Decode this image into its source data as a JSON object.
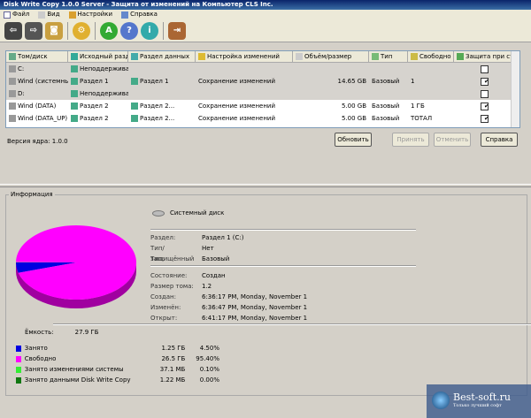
{
  "window": {
    "title": "Disk Write Copy 1.0.0 Server - Защита от изменений на Компьютер CLS Inc."
  },
  "menu": [
    "Файл",
    "Вид",
    "Настройки",
    "Справка"
  ],
  "toolbar": [
    "back",
    "forward",
    "disk",
    "settings",
    "apply",
    "help",
    "info",
    "exit"
  ],
  "columns": [
    "Том/диск",
    "Исходный раздел",
    "Раздел данных",
    "Настройка изменений",
    "Объём/размер",
    "Тип",
    "Свободно",
    "Защита при старте"
  ],
  "rows": [
    {
      "c": [
        "C:",
        "Неподдерживаемый",
        "",
        "",
        "",
        "",
        "",
        ""
      ],
      "checked": false,
      "gray": true
    },
    {
      "c": [
        "Wind (системный)",
        "Раздел 1",
        "Раздел 1",
        "Сохранение изменений",
        "14.65 GB",
        "Базовый",
        "1",
        ""
      ],
      "checked": true,
      "gray": true
    },
    {
      "c": [
        "D:",
        "Неподдерживаемый",
        "",
        "",
        "",
        "",
        "",
        ""
      ],
      "checked": false,
      "gray": true
    },
    {
      "c": [
        "Wind (DATA)",
        "Раздел 2",
        "Раздел 2...",
        "Сохранение изменений",
        "5.00 GB",
        "Базовый",
        "1 ГБ",
        ""
      ],
      "checked": true,
      "gray": false
    },
    {
      "c": [
        "Wind (DATA_UP)",
        "Раздел 2",
        "Раздел 2...",
        "Сохранение изменений",
        "5.00 GB",
        "Базовый",
        "ТОТАЛ",
        ""
      ],
      "checked": true,
      "gray": false
    }
  ],
  "status": {
    "label": "Версия ядра:",
    "value": "1.0.0"
  },
  "buttons": {
    "refresh": "Обновить",
    "apply": "Принять",
    "cancel": "Отменить",
    "help": "Справка"
  },
  "info": {
    "group_label": "Информация",
    "disk_name": "Системный диск",
    "details1": [
      [
        "Раздел:",
        "Раздел 1 (C:)"
      ],
      [
        "Тип/защищённый",
        "Нет"
      ],
      [
        "Тип:",
        "Базовый"
      ]
    ],
    "details2": [
      [
        "Состояние:",
        "Создан"
      ],
      [
        "Размер тома:",
        "1.2"
      ],
      [
        "Создан:",
        "6:36:17 PM, Monday, November 1"
      ],
      [
        "Изменён:",
        "6:36:47 PM, Monday, November 1"
      ],
      [
        "Открыт:",
        "6:41:17 PM, Monday, November 1"
      ]
    ],
    "capacity_label": "Ёмкость:",
    "capacity": "27.9 ГБ"
  },
  "chart_data": {
    "type": "pie",
    "series": [
      {
        "name": "Занято",
        "value_text": "1.25 ГБ",
        "percent": 4.5,
        "percent_text": "4.50%",
        "color": "#0000e0"
      },
      {
        "name": "Свободно",
        "value_text": "26.5 ГБ",
        "percent": 95.4,
        "percent_text": "95.40%",
        "color": "#ff00ff"
      },
      {
        "name": "Занято изменениями системы",
        "value_text": "37.1 МБ",
        "percent": 0.1,
        "percent_text": "0.10%",
        "color": "#33ee33"
      },
      {
        "name": "Занято данными Disk Write Copy",
        "value_text": "1.22 МБ",
        "percent": 0.0,
        "percent_text": "0.00%",
        "color": "#117711"
      }
    ]
  },
  "watermark": {
    "title": "Best-soft.ru",
    "sub": "Только лучший софт"
  }
}
